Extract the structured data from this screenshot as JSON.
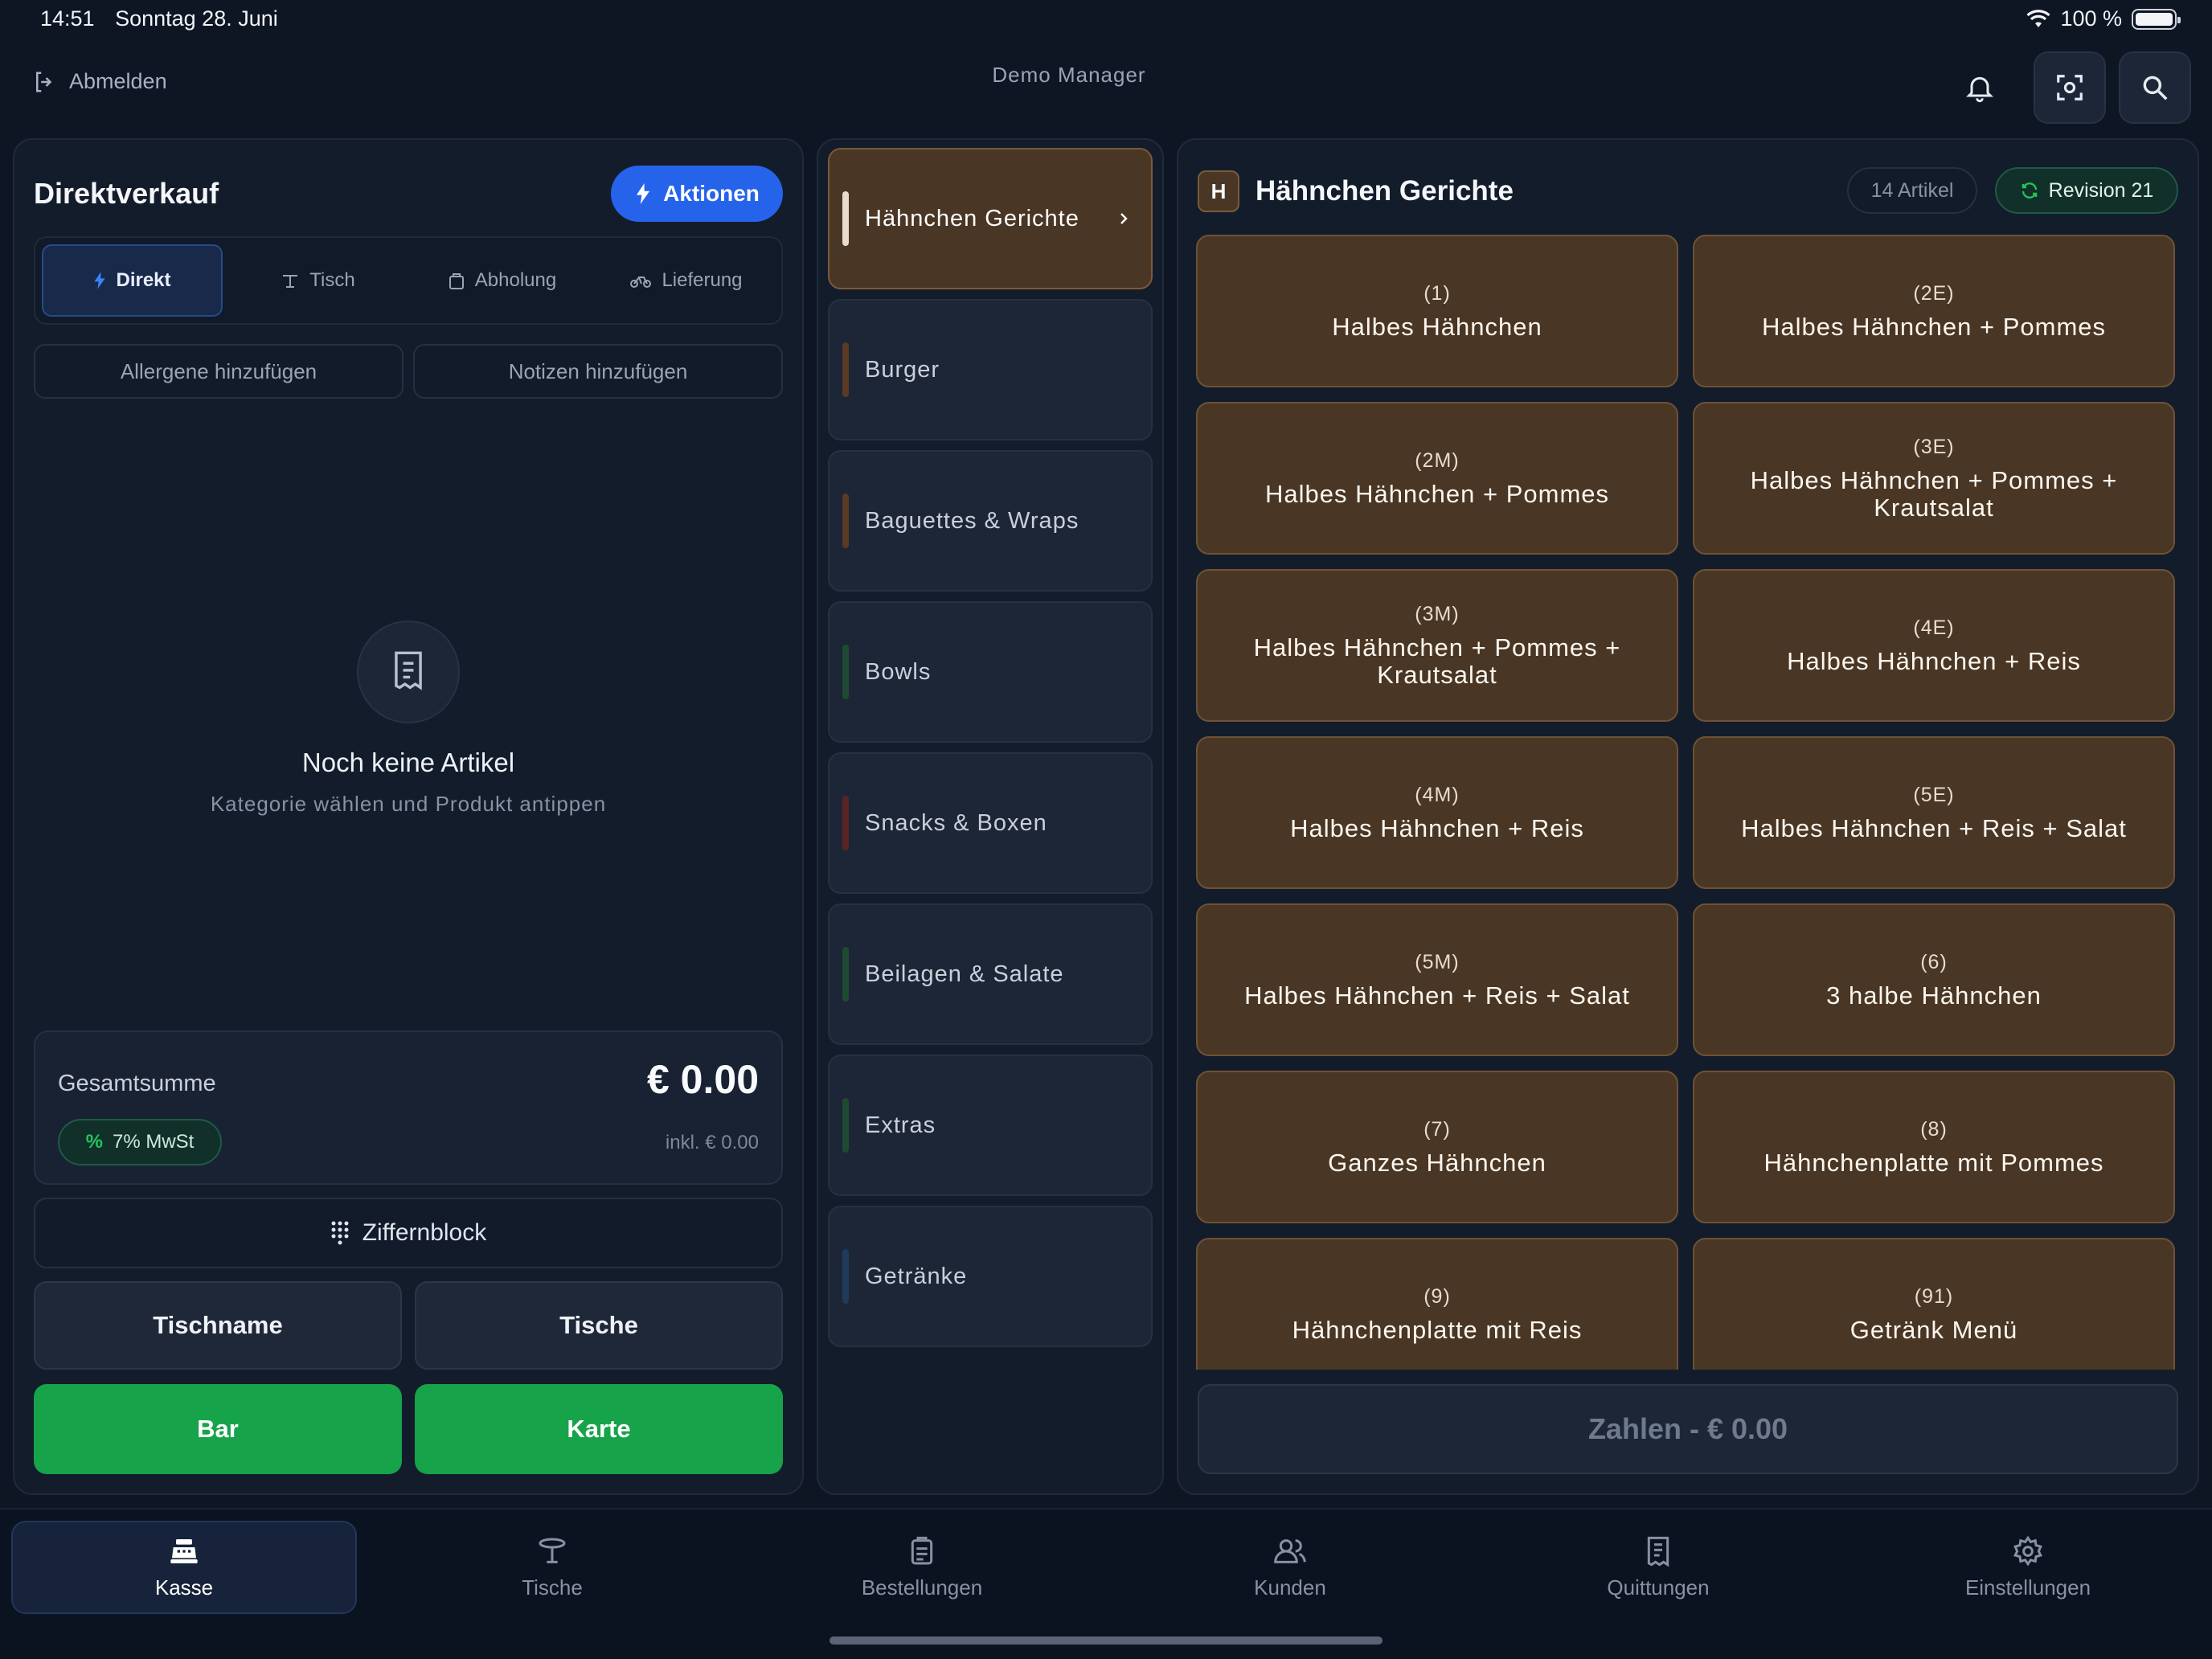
{
  "status": {
    "time": "14:51",
    "date": "Sonntag 28. Juni",
    "battery": "100 %"
  },
  "topbar": {
    "logout_label": "Abmelden",
    "manager": "Demo Manager"
  },
  "left": {
    "title": "Direktverkauf",
    "actions_label": "Aktionen",
    "modes": [
      {
        "label": "Direkt",
        "icon": "bolt-icon",
        "active": true
      },
      {
        "label": "Tisch",
        "icon": "table-icon"
      },
      {
        "label": "Abholung",
        "icon": "bag-icon"
      },
      {
        "label": "Lieferung",
        "icon": "bike-icon"
      }
    ],
    "allergens_label": "Allergene hinzufügen",
    "notes_label": "Notizen hinzufügen",
    "empty_title": "Noch keine Artikel",
    "empty_sub": "Kategorie wählen und Produkt antippen",
    "total_label": "Gesamtsumme",
    "total_value": "€ 0.00",
    "vat_label": "7% MwSt",
    "incl_label": "inkl. € 0.00",
    "keypad_label": "Ziffernblock",
    "tablename_label": "Tischname",
    "tables_label": "Tische",
    "cash_label": "Bar",
    "card_label": "Karte"
  },
  "categories": [
    {
      "label": "Hähnchen Gerichte",
      "color": "#c9b69a",
      "active": true
    },
    {
      "label": "Burger",
      "color": "#5a3a24"
    },
    {
      "label": "Baguettes & Wraps",
      "color": "#5a3a24"
    },
    {
      "label": "Bowls",
      "color": "#1f4a32"
    },
    {
      "label": "Snacks & Boxen",
      "color": "#5a2424"
    },
    {
      "label": "Beilagen & Salate",
      "color": "#1f4a32"
    },
    {
      "label": "Extras",
      "color": "#1f4a32"
    },
    {
      "label": "Getränke",
      "color": "#1f3a5a"
    }
  ],
  "products_panel": {
    "badge": "H",
    "title": "Hähnchen Gerichte",
    "count": "14 Artikel",
    "revision": "Revision 21",
    "pay_label": "Zahlen - € 0.00",
    "items": [
      {
        "code": "(1)",
        "name": "Halbes Hähnchen"
      },
      {
        "code": "(2E)",
        "name": "Halbes Hähnchen + Pommes"
      },
      {
        "code": "(2M)",
        "name": "Halbes Hähnchen + Pommes"
      },
      {
        "code": "(3E)",
        "name": "Halbes Hähnchen + Pommes + Krautsalat"
      },
      {
        "code": "(3M)",
        "name": "Halbes Hähnchen + Pommes + Krautsalat"
      },
      {
        "code": "(4E)",
        "name": "Halbes Hähnchen + Reis"
      },
      {
        "code": "(4M)",
        "name": "Halbes Hähnchen + Reis"
      },
      {
        "code": "(5E)",
        "name": "Halbes Hähnchen + Reis + Salat"
      },
      {
        "code": "(5M)",
        "name": "Halbes Hähnchen + Reis + Salat"
      },
      {
        "code": "(6)",
        "name": "3 halbe Hähnchen"
      },
      {
        "code": "(7)",
        "name": "Ganzes Hähnchen"
      },
      {
        "code": "(8)",
        "name": "Hähnchenplatte mit Pommes"
      },
      {
        "code": "(9)",
        "name": "Hähnchenplatte mit Reis"
      },
      {
        "code": "(91)",
        "name": "Getränk Menü"
      }
    ]
  },
  "nav": [
    {
      "label": "Kasse",
      "icon": "register-icon",
      "active": true
    },
    {
      "label": "Tische",
      "icon": "table-icon"
    },
    {
      "label": "Bestellungen",
      "icon": "clipboard-icon"
    },
    {
      "label": "Kunden",
      "icon": "users-icon"
    },
    {
      "label": "Quittungen",
      "icon": "receipt-icon"
    },
    {
      "label": "Einstellungen",
      "icon": "gear-icon"
    }
  ]
}
